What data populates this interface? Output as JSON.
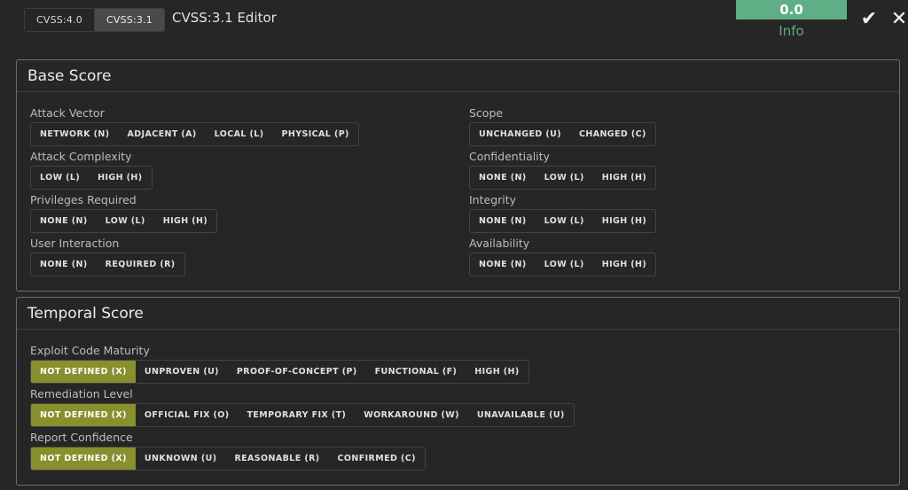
{
  "header": {
    "versions": [
      {
        "label": "CVSS:4.0",
        "active": false
      },
      {
        "label": "CVSS:3.1",
        "active": true
      }
    ],
    "title": "CVSS:3.1 Editor",
    "score": "0.0",
    "severity": "Info",
    "confirm_icon": "check-icon",
    "close_icon": "close-icon"
  },
  "colors": {
    "score_bg": "#5fae85",
    "selected_option": "#87902c",
    "background": "#262626"
  },
  "base": {
    "title": "Base Score",
    "attack_vector": {
      "label": "Attack Vector",
      "options": [
        "NETWORK (N)",
        "ADJACENT (A)",
        "LOCAL (L)",
        "PHYSICAL (P)"
      ],
      "selected": null
    },
    "attack_complexity": {
      "label": "Attack Complexity",
      "options": [
        "LOW (L)",
        "HIGH (H)"
      ],
      "selected": null
    },
    "privileges_required": {
      "label": "Privileges Required",
      "options": [
        "NONE (N)",
        "LOW (L)",
        "HIGH (H)"
      ],
      "selected": null
    },
    "user_interaction": {
      "label": "User Interaction",
      "options": [
        "NONE (N)",
        "REQUIRED (R)"
      ],
      "selected": null
    },
    "scope": {
      "label": "Scope",
      "options": [
        "UNCHANGED (U)",
        "CHANGED (C)"
      ],
      "selected": null
    },
    "confidentiality": {
      "label": "Confidentiality",
      "options": [
        "NONE (N)",
        "LOW (L)",
        "HIGH (H)"
      ],
      "selected": null
    },
    "integrity": {
      "label": "Integrity",
      "options": [
        "NONE (N)",
        "LOW (L)",
        "HIGH (H)"
      ],
      "selected": null
    },
    "availability": {
      "label": "Availability",
      "options": [
        "NONE (N)",
        "LOW (L)",
        "HIGH (H)"
      ],
      "selected": null
    }
  },
  "temporal": {
    "title": "Temporal Score",
    "exploit_code_maturity": {
      "label": "Exploit Code Maturity",
      "options": [
        "NOT DEFINED (X)",
        "UNPROVEN (U)",
        "PROOF-OF-CONCEPT (P)",
        "FUNCTIONAL (F)",
        "HIGH (H)"
      ],
      "selected": 0
    },
    "remediation_level": {
      "label": "Remediation Level",
      "options": [
        "NOT DEFINED (X)",
        "OFFICIAL FIX (O)",
        "TEMPORARY FIX (T)",
        "WORKAROUND (W)",
        "UNAVAILABLE (U)"
      ],
      "selected": 0
    },
    "report_confidence": {
      "label": "Report Confidence",
      "options": [
        "NOT DEFINED (X)",
        "UNKNOWN (U)",
        "REASONABLE (R)",
        "CONFIRMED (C)"
      ],
      "selected": 0
    }
  }
}
